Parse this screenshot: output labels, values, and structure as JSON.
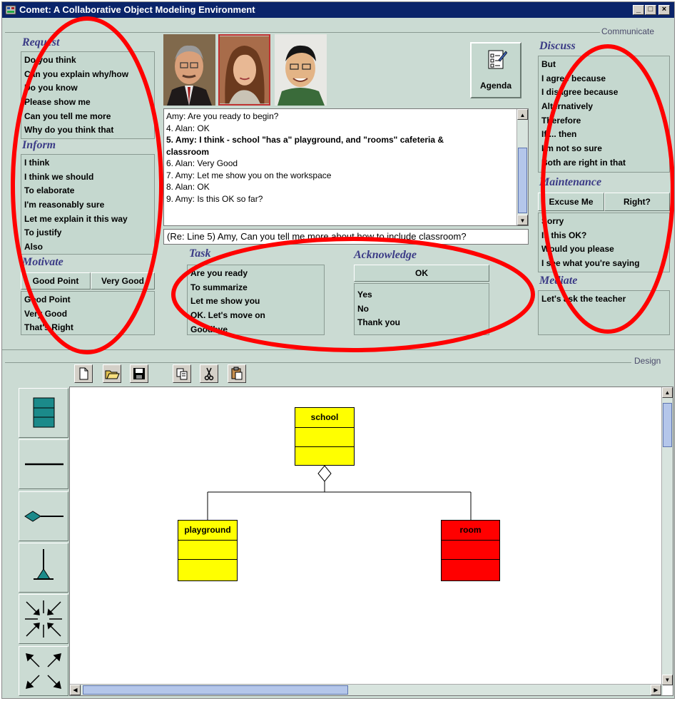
{
  "window": {
    "title": "Comet: A Collaborative Object Modeling Environment"
  },
  "communicate_label": "Communicate",
  "design_label": "Design",
  "request": {
    "title": "Request",
    "items": [
      "Do you think",
      "Can you explain why/how",
      "Do you know",
      "Please show me",
      "Can you tell me more",
      "Why do you think that"
    ]
  },
  "inform": {
    "title": "Inform",
    "items": [
      "I think",
      "I think we should",
      "To elaborate",
      "I'm reasonably sure",
      "Let me explain it this way",
      "To justify",
      "Also"
    ]
  },
  "motivate": {
    "title": "Motivate",
    "buttons": [
      "Good Point",
      "Very Good"
    ],
    "items": [
      "Good Point",
      "Very Good",
      "That's Right"
    ]
  },
  "task": {
    "title": "Task",
    "items": [
      "Are you ready",
      "To summarize",
      "Let me show you",
      "OK. Let's move on",
      "Goodbye"
    ]
  },
  "acknowledge": {
    "title": "Acknowledge",
    "button": "OK",
    "items": [
      "Yes",
      "No",
      "Thank you"
    ]
  },
  "discuss": {
    "title": "Discuss",
    "items": [
      "But",
      "I agree because",
      "I disagree because",
      "Alternatively",
      "Therefore",
      "If ... then",
      "I'm not so sure",
      "Both are right in that"
    ]
  },
  "maintenance": {
    "title": "Maintenance",
    "buttons": [
      "Excuse Me",
      "Right?"
    ],
    "items": [
      "Sorry",
      "Is this OK?",
      "Would you please",
      "I see what you're saying"
    ]
  },
  "mediate": {
    "title": "Mediate",
    "items": [
      "Let's ask the teacher"
    ]
  },
  "agenda": {
    "label": "Agenda"
  },
  "chat": {
    "lines": [
      {
        "text": "Amy: Are you ready to begin?",
        "bold": false
      },
      {
        "text": "4. Alan: OK",
        "bold": false
      },
      {
        "text": "5. Amy: I think - school \"has a\" playground, and \"rooms\" cafeteria &",
        "bold": true
      },
      {
        "text": "classroom",
        "bold": true
      },
      {
        "text": "6. Alan: Very Good",
        "bold": false
      },
      {
        "text": "7. Amy: Let me show you on the workspace",
        "bold": false
      },
      {
        "text": "8. Alan: OK",
        "bold": false
      },
      {
        "text": "9. Amy: Is this OK so far?",
        "bold": false
      }
    ],
    "input_value": "(Re: Line 5) Amy, Can you tell me more about how to include classroom?"
  },
  "diagram": {
    "classes": [
      {
        "name": "school",
        "color": "#ffff00"
      },
      {
        "name": "playground",
        "color": "#ffff00"
      },
      {
        "name": "room",
        "color": "#ff0000"
      }
    ]
  },
  "colors": {
    "titlebar": "#0a246a",
    "panel": "#cbdbd3",
    "annotation": "#ff0000",
    "class_teal": "#1b8a8a"
  }
}
